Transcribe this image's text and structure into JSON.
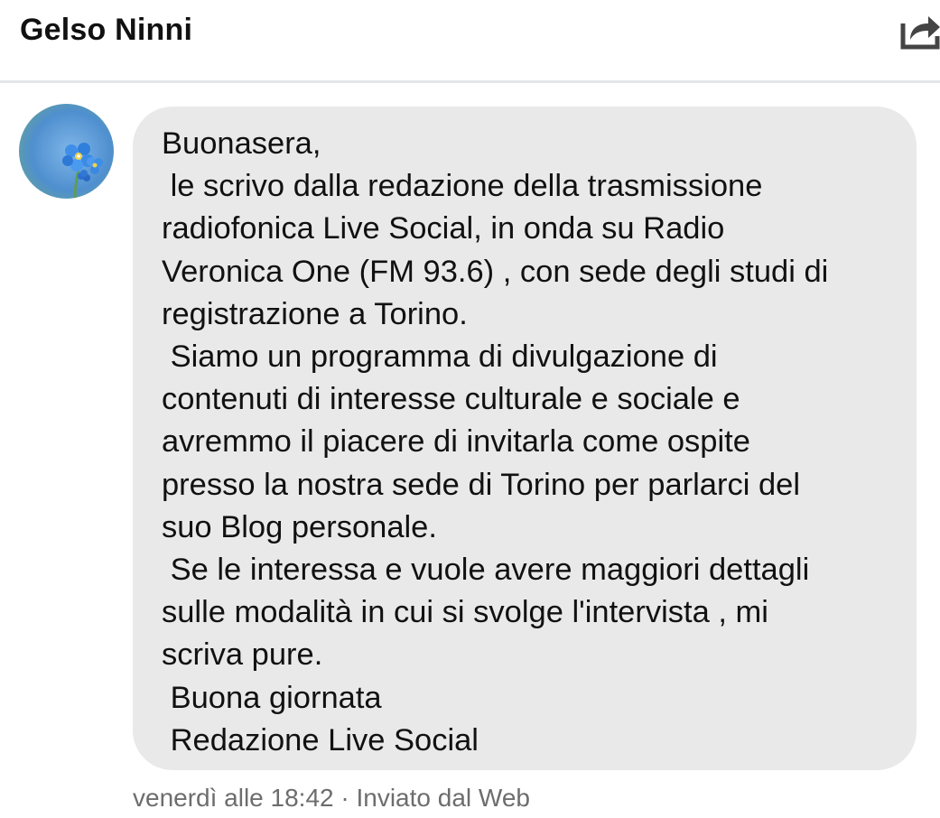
{
  "header": {
    "title": "Gelso Ninni",
    "share_icon": "share-icon"
  },
  "avatar": {
    "icon": "avatar-flower-icon",
    "colors": {
      "background": "#5f9fd8",
      "petal": "#4aa3f0"
    }
  },
  "message": {
    "text": "Buonasera,\n le scrivo dalla redazione della trasmissione\nradiofonica Live Social, in onda su Radio\nVeronica One (FM 93.6) , con sede degli studi di\nregistrazione a Torino.\n Siamo un programma di divulgazione di\ncontenuti di interesse culturale e sociale e\navremmo il piacere di invitarla come ospite\npresso la nostra sede di Torino per parlarci del\nsuo Blog personale.\n Se le interessa e vuole avere maggiori dettagli\nsulle modalità in cui si svolge l'intervista , mi\nscriva pure.\n Buona giornata\n Redazione Live Social",
    "bubble_color": "#e9e9e9"
  },
  "meta": {
    "text": "venerdì alle 18:42 · Inviato dal Web"
  }
}
